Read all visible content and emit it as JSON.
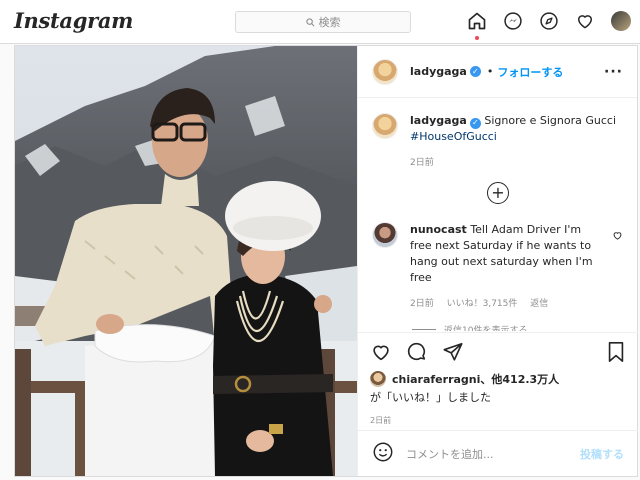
{
  "nav": {
    "logo": "Instagram",
    "search_placeholder": "検索"
  },
  "post": {
    "author": "ladygaga",
    "follow_label": "フォローする",
    "separator": "•",
    "caption": "Signore e Signora Gucci",
    "hashtag": "#HouseOfGucci",
    "caption_time": "2日前",
    "comment": {
      "author": "nunocast",
      "text": "Tell Adam Driver I'm free next Saturday if he wants to hang out next saturday when I'm free",
      "time": "2日前",
      "likes": "いいね！3,715件",
      "reply_label": "返信",
      "more_replies": "返信10件を表示する"
    },
    "likes_line1_user": "chiaraferragni",
    "likes_line1_rest": "、他412.3万人",
    "likes_line2": "が「いいね！」しました",
    "date": "2日前",
    "add_comment_placeholder": "コメントを追加...",
    "post_button": "投稿する"
  },
  "colors": {
    "link": "#0095f6",
    "border": "#dbdbdb",
    "muted": "#8e8e8e"
  }
}
